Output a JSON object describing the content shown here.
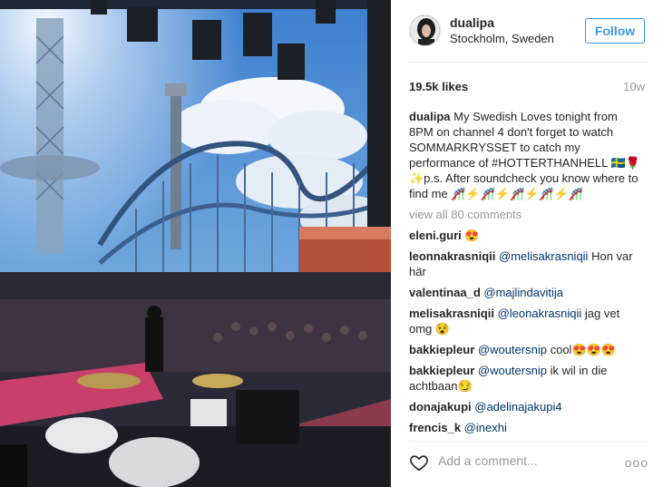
{
  "post": {
    "username": "dualipa",
    "location": "Stockholm, Sweden",
    "follow_label": "Follow",
    "likes": "19.5k likes",
    "time": "10w",
    "caption": "My Swedish Loves tonight from 8PM on channel 4 don't forget to watch SOMMARKRYSSET to catch my performance of #HOTTERTHANHELL 🇸🇪🌹✨p.s. After soundcheck you know where to find me 🎢⚡🎢⚡🎢⚡🎢⚡🎢",
    "view_all": "view all 80 comments"
  },
  "comments": [
    {
      "user": "eleni.guri",
      "mention": "",
      "text": "😍"
    },
    {
      "user": "leonnakrasniqii",
      "mention": "@melisakrasniqii",
      "text": "Hon var här"
    },
    {
      "user": "valentinaa_d",
      "mention": "@majlindavitija",
      "text": ""
    },
    {
      "user": "melisakrasniqii",
      "mention": "@leonakrasniqii",
      "text": "jag vet omg 😵"
    },
    {
      "user": "bakkiepleur",
      "mention": "@woutersnip",
      "text": "cool😍😍😍"
    },
    {
      "user": "bakkiepleur",
      "mention": "@woutersnip",
      "text": "ik wil in die achtbaan😏"
    },
    {
      "user": "donajakupi",
      "mention": "@adelinajakupi4",
      "text": ""
    },
    {
      "user": "frencis_k",
      "mention": "@inexhi",
      "text": ""
    }
  ],
  "footer": {
    "add_comment_placeholder": "Add a comment...",
    "more_label": "ooo"
  },
  "icons": {
    "heart": "heart-icon",
    "more": "more-options-icon"
  },
  "colors": {
    "accent": "#3897f0",
    "mention": "#003569",
    "muted": "#999999"
  }
}
